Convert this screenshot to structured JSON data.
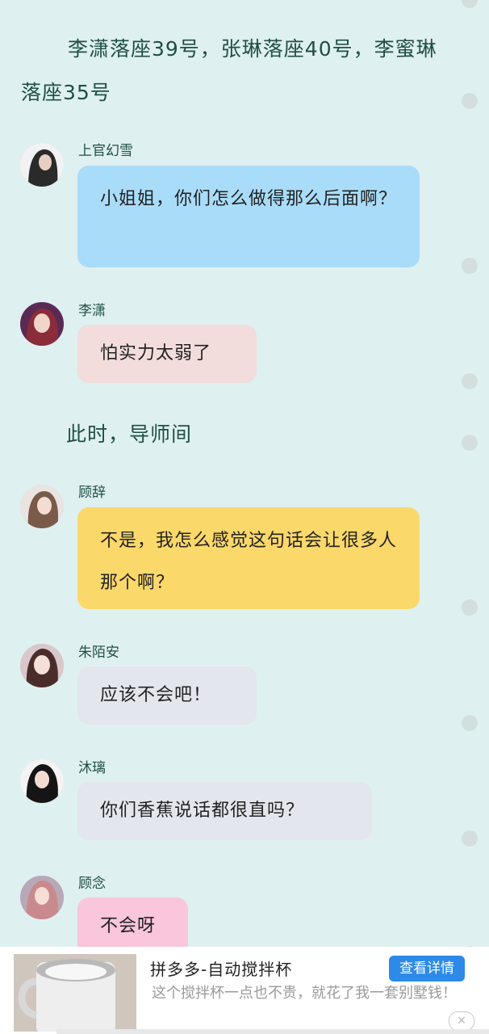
{
  "narration": [
    "李潇落座39号，张琳落座40号，李蜜琳落座35号",
    "此时，导师间"
  ],
  "messages": [
    {
      "name": "上官幻雪",
      "text": "小姐姐，你们怎么做得那么后面啊？",
      "bubble_color": "#a9dcf9"
    },
    {
      "name": "李潇",
      "text": "怕实力太弱了",
      "bubble_color": "#f2dcdc"
    },
    {
      "name": "顾辞",
      "text": "不是，我怎么感觉这句话会让很多人那个啊？",
      "bubble_color": "#fbd86a"
    },
    {
      "name": "朱陌安",
      "text": "应该不会吧！",
      "bubble_color": "#e3e6ec"
    },
    {
      "name": "沐璃",
      "text": "你们香蕉说话都很直吗？",
      "bubble_color": "#e3e6ec"
    },
    {
      "name": "顾念",
      "text": "不会呀",
      "bubble_color": "#f9c6db"
    }
  ],
  "ad": {
    "title": "拼多多-自动搅拌杯",
    "description": "这个搅拌杯一点也不贵，就花了我一套别墅钱！",
    "button_label": "查看详情",
    "close_label": "✕"
  }
}
